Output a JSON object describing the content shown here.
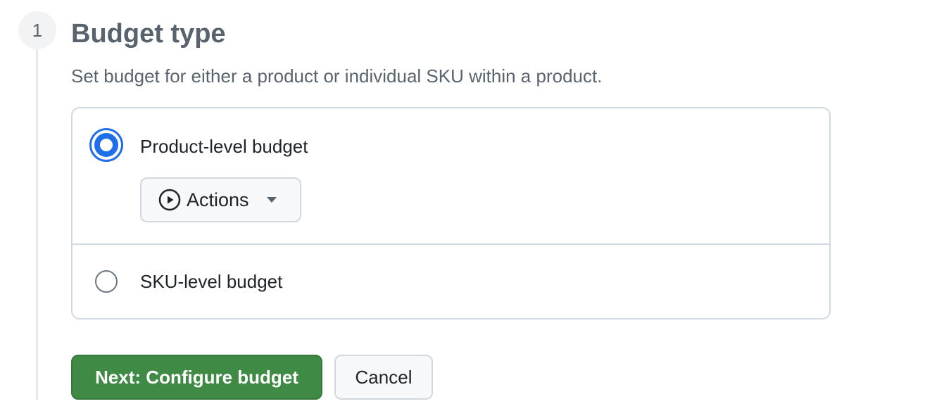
{
  "step": {
    "number": "1",
    "title": "Budget type",
    "description": "Set budget for either a product or individual SKU within a product."
  },
  "options": {
    "product": {
      "label": "Product-level budget",
      "selected": true,
      "product_select": {
        "icon": "play-circle-icon",
        "value": "Actions"
      }
    },
    "sku": {
      "label": "SKU-level budget",
      "selected": false
    }
  },
  "buttons": {
    "next_label": "Next: Configure budget",
    "cancel_label": "Cancel"
  },
  "colors": {
    "accent": "#1f6feb",
    "primary_button": "#3f8b46",
    "muted_text": "#59636e",
    "border": "#d1d9e0"
  }
}
